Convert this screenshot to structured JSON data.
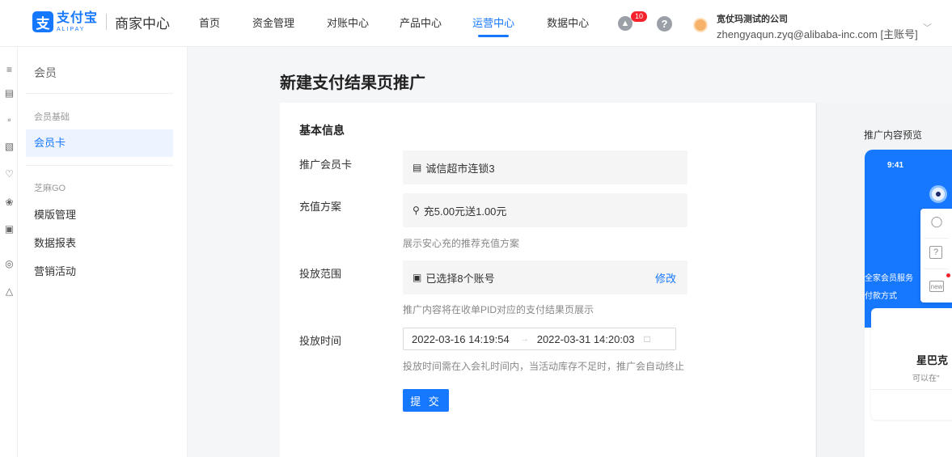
{
  "header": {
    "logo_mark": "支",
    "logo_cn": "支付宝",
    "logo_en": "ALIPAY",
    "app_name": "商家中心",
    "nav": [
      {
        "label": "首页"
      },
      {
        "label": "资金管理"
      },
      {
        "label": "对账中心"
      },
      {
        "label": "产品中心"
      },
      {
        "label": "运营中心",
        "active": true
      },
      {
        "label": "数据中心"
      }
    ],
    "bell_icon": "bell-icon",
    "notification_count": "10",
    "help_icon": "?",
    "company_name": "宽仗玛测试的公司",
    "account": "zhengyaqun.zyq@alibaba-inc.com [主账号]",
    "caret": "﹀"
  },
  "rail": {
    "icons": [
      "menu-icon",
      "chart-icon",
      "document-icon",
      "gift-icon",
      "heart-icon",
      "badge-icon",
      "coupon-icon",
      "target-icon",
      "sprout-icon"
    ]
  },
  "sidebar": {
    "title": "会员",
    "group1": "会员基础",
    "item_member_card": "会员卡",
    "group2": "芝麻GO",
    "item_templates": "模版管理",
    "item_reports": "数据报表",
    "item_campaigns": "营销活动"
  },
  "main": {
    "page_title": "新建支付结果页推广",
    "section_title": "基本信息",
    "card_label": "推广会员卡",
    "card_value": "诚信超市连锁3",
    "plan_label": "充值方案",
    "plan_value": "充5.00元送1.00元",
    "plan_hint": "展示安心充的推荐充值方案",
    "scope_label": "投放范围",
    "scope_value": "已选择8个账号",
    "scope_edit": "修改",
    "scope_hint": "推广内容将在收单PID对应的支付结果页展示",
    "time_label": "投放时间",
    "time_start": "2022-03-16 14:19:54",
    "time_arrow": "→",
    "time_end": "2022-03-31 14:20:03",
    "time_hint": "投放时间需在入会礼时间内，当活动库存不足时，推广会自动终止",
    "submit": "提 交"
  },
  "preview": {
    "title": "推广内容预览",
    "time": "9:41",
    "text1": "全家会员服务",
    "text2": "付款方式",
    "brand": "星巴克",
    "sub": "可以在\""
  },
  "colors": {
    "accent": "#1677ff",
    "badge": "#f5222d"
  }
}
